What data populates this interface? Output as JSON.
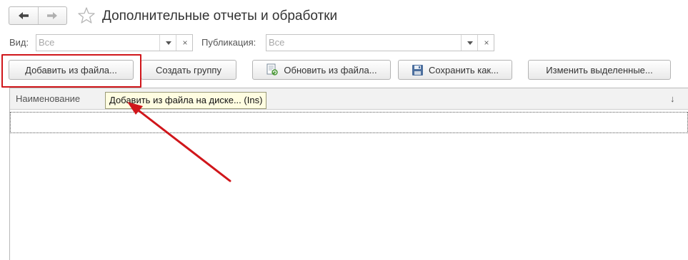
{
  "window": {
    "title": "Дополнительные отчеты и обработки"
  },
  "nav": {
    "back_icon": "arrow-left-icon",
    "forward_icon": "arrow-right-icon",
    "favorite_icon": "star-icon"
  },
  "filters": {
    "kind_label": "Вид:",
    "kind_value": "Все",
    "publication_label": "Публикация:",
    "publication_value": "Все"
  },
  "toolbar": {
    "add_from_file": "Добавить из файла...",
    "create_group": "Создать группу",
    "update_from_file": "Обновить из файла...",
    "save_as": "Сохранить как...",
    "change_selected": "Изменить выделенные..."
  },
  "table": {
    "columns": [
      {
        "label": "Наименование"
      }
    ],
    "sort_indicator": "↓"
  },
  "tooltip": {
    "text": "Добавить из файла на диске... (Ins)"
  },
  "annotation": {
    "highlight_color": "#d0161b"
  }
}
